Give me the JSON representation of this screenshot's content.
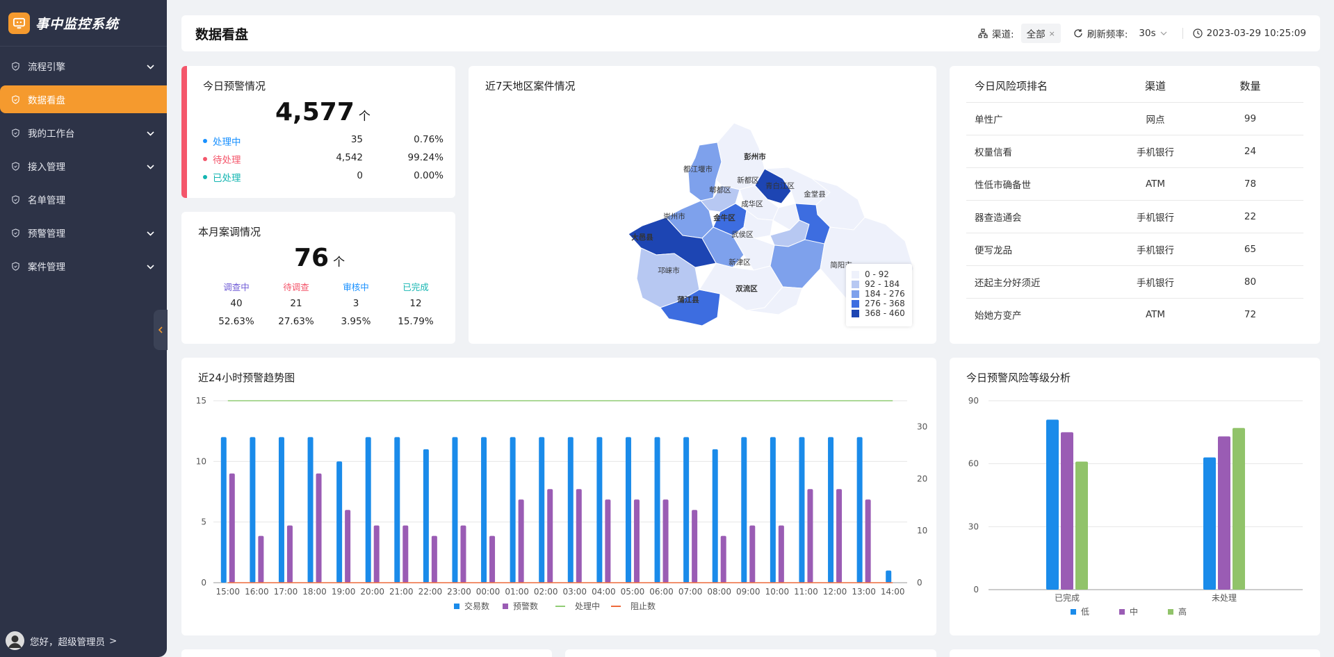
{
  "app": {
    "title": "事中监控系统"
  },
  "sidebar": {
    "items": [
      {
        "label": "流程引擎",
        "has_children": true,
        "active": false
      },
      {
        "label": "数据看盘",
        "has_children": false,
        "active": true
      },
      {
        "label": "我的工作台",
        "has_children": true,
        "active": false
      },
      {
        "label": "接入管理",
        "has_children": true,
        "active": false
      },
      {
        "label": "名单管理",
        "has_children": false,
        "active": false
      },
      {
        "label": "预警管理",
        "has_children": true,
        "active": false
      },
      {
        "label": "案件管理",
        "has_children": true,
        "active": false
      }
    ],
    "user_greeting": "您好，超级管理员",
    "user_chevron": ">"
  },
  "header": {
    "title": "数据看盘",
    "channel_label": "渠道:",
    "channel_value": "全部",
    "channel_clear": "×",
    "refresh_label": "刷新频率:",
    "refresh_value": "30s",
    "datetime": "2023-03-29 10:25:09"
  },
  "today_alert": {
    "title": "今日预警情况",
    "total": "4,577",
    "unit": "个",
    "rows": [
      {
        "label": "处理中",
        "count": "35",
        "pct": "0.76%",
        "color": "#1890ff"
      },
      {
        "label": "待处理",
        "count": "4,542",
        "pct": "99.24%",
        "color": "#f4566b"
      },
      {
        "label": "已处理",
        "count": "0",
        "pct": "0.00%",
        "color": "#13b5b1"
      }
    ]
  },
  "month_case": {
    "title": "本月案调情况",
    "total": "76",
    "unit": "个",
    "columns": [
      {
        "label": "调查中",
        "count": "40",
        "pct": "52.63%",
        "color": "#6f5bd6"
      },
      {
        "label": "待调查",
        "count": "21",
        "pct": "27.63%",
        "color": "#f4566b"
      },
      {
        "label": "审核中",
        "count": "3",
        "pct": "3.95%",
        "color": "#1890ff"
      },
      {
        "label": "已完成",
        "count": "12",
        "pct": "15.79%",
        "color": "#13b5b1"
      }
    ]
  },
  "map": {
    "title": "近7天地区案件情况",
    "legend": [
      {
        "label": "0 - 92",
        "color": "#eef1fb"
      },
      {
        "label": "92 - 184",
        "color": "#b7c8f2"
      },
      {
        "label": "184 - 276",
        "color": "#7ea1ec"
      },
      {
        "label": "276 - 368",
        "color": "#3d6de0"
      },
      {
        "label": "368 - 460",
        "color": "#1d45b3"
      }
    ],
    "regions": [
      "都江堰市",
      "彭州市",
      "郫都区",
      "青白江区",
      "新都区",
      "崇州市",
      "金牛区",
      "成华区",
      "金堂县",
      "大邑县",
      "武侯区",
      "邛崃市",
      "新津区",
      "双流区",
      "简阳市",
      "蒲江县"
    ]
  },
  "rank": {
    "headers": [
      "今日风险项排名",
      "渠道",
      "数量"
    ],
    "rows": [
      {
        "name": "单性广",
        "channel": "网点",
        "count": "99"
      },
      {
        "name": "权量信看",
        "channel": "手机银行",
        "count": "24"
      },
      {
        "name": "性低市确备世",
        "channel": "ATM",
        "count": "78"
      },
      {
        "name": "器查造通会",
        "channel": "手机银行",
        "count": "22"
      },
      {
        "name": "便写龙品",
        "channel": "手机银行",
        "count": "65"
      },
      {
        "name": "还起主分好须近",
        "channel": "手机银行",
        "count": "80"
      },
      {
        "name": "始她方变产",
        "channel": "ATM",
        "count": "72"
      }
    ]
  },
  "chart_data": [
    {
      "type": "bar",
      "title": "近24小时预警趋势图",
      "categories": [
        "15:00",
        "16:00",
        "17:00",
        "18:00",
        "19:00",
        "20:00",
        "21:00",
        "22:00",
        "23:00",
        "00:00",
        "01:00",
        "02:00",
        "03:00",
        "04:00",
        "05:00",
        "06:00",
        "07:00",
        "08:00",
        "09:00",
        "10:00",
        "11:00",
        "12:00",
        "13:00",
        "14:00"
      ],
      "series": [
        {
          "name": "交易数",
          "kind": "bar",
          "axis": "left",
          "color": "#1a8bea",
          "values": [
            12,
            12,
            12,
            12,
            10,
            12,
            12,
            11,
            12,
            12,
            12,
            12,
            12,
            12,
            12,
            12,
            12,
            11,
            12,
            12,
            12,
            12,
            12,
            1
          ]
        },
        {
          "name": "预警数",
          "kind": "bar",
          "axis": "right",
          "color": "#9a5cb4",
          "values": [
            21,
            9,
            11,
            21,
            14,
            11,
            11,
            9,
            11,
            9,
            16,
            18,
            18,
            16,
            16,
            16,
            14,
            9,
            11,
            11,
            18,
            18,
            16,
            0
          ]
        },
        {
          "name": "处理中",
          "kind": "line",
          "axis": "left",
          "color": "#91cc75",
          "values": [
            15,
            15,
            15,
            15,
            15,
            15,
            15,
            15,
            15,
            15,
            15,
            15,
            15,
            15,
            15,
            15,
            15,
            15,
            15,
            15,
            15,
            15,
            15,
            15
          ]
        },
        {
          "name": "阻止数",
          "kind": "line",
          "axis": "left",
          "color": "#ee6a3b",
          "values": [
            0,
            0,
            0,
            0,
            0,
            0,
            0,
            0,
            0,
            0,
            0,
            0,
            0,
            0,
            0,
            0,
            0,
            0,
            0,
            0,
            0,
            0,
            0,
            0
          ]
        }
      ],
      "ylim": [
        0,
        15
      ],
      "yticks": [
        0,
        5,
        10,
        15
      ],
      "y2lim": [
        0,
        35
      ],
      "y2ticks": [
        0,
        10,
        20,
        30
      ],
      "legend": "bottom"
    },
    {
      "type": "bar",
      "title": "今日预警风险等级分析",
      "categories": [
        "已完成",
        "未处理"
      ],
      "series": [
        {
          "name": "低",
          "color": "#1a8bea",
          "values": [
            81,
            63
          ]
        },
        {
          "name": "中",
          "color": "#9a5cb4",
          "values": [
            75,
            73
          ]
        },
        {
          "name": "高",
          "color": "#91c36a",
          "values": [
            61,
            77
          ]
        }
      ],
      "ylim": [
        0,
        90
      ],
      "yticks": [
        0,
        30,
        60,
        90
      ],
      "legend": "bottom"
    }
  ]
}
